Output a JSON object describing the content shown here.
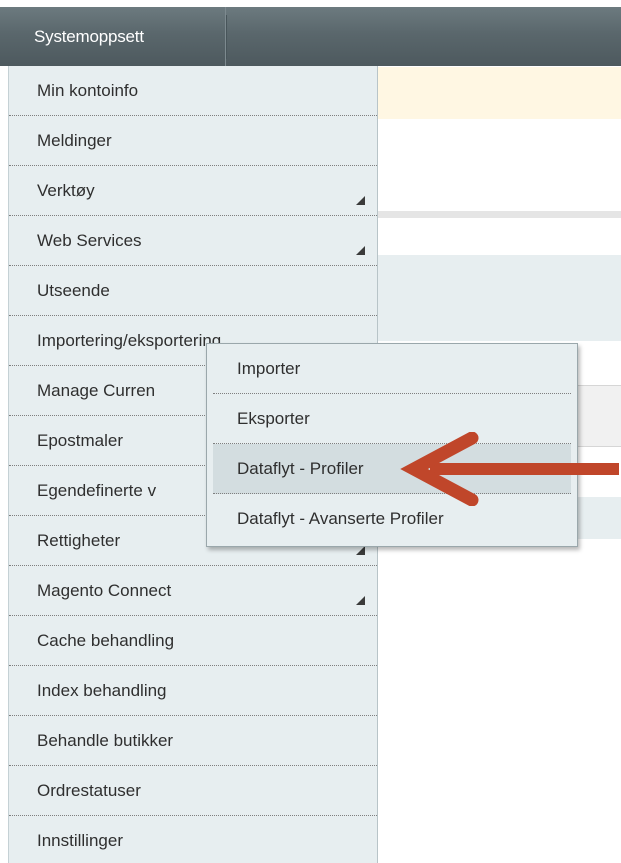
{
  "topbar": {
    "tab_label": "Systemoppsett"
  },
  "menu": {
    "items": [
      {
        "label": "Min kontoinfo",
        "has_submenu": false
      },
      {
        "label": "Meldinger",
        "has_submenu": false
      },
      {
        "label": "Verktøy",
        "has_submenu": true
      },
      {
        "label": "Web Services",
        "has_submenu": true
      },
      {
        "label": "Utseende",
        "has_submenu": false
      },
      {
        "label": "Importering/eksportering",
        "has_submenu": true
      },
      {
        "label": "Manage Curren",
        "has_submenu": false
      },
      {
        "label": "Epostmaler",
        "has_submenu": false
      },
      {
        "label": "Egendefinerte v",
        "has_submenu": false
      },
      {
        "label": "Rettigheter",
        "has_submenu": true
      },
      {
        "label": "Magento Connect",
        "has_submenu": true
      },
      {
        "label": "Cache behandling",
        "has_submenu": false
      },
      {
        "label": "Index behandling",
        "has_submenu": false
      },
      {
        "label": "Behandle butikker",
        "has_submenu": false
      },
      {
        "label": "Ordrestatuser",
        "has_submenu": false
      },
      {
        "label": "Innstillinger",
        "has_submenu": false
      }
    ]
  },
  "submenu": {
    "items": [
      {
        "label": "Importer"
      },
      {
        "label": "Eksporter"
      },
      {
        "label": "Dataflyt - Profiler",
        "active": true
      },
      {
        "label": "Dataflyt - Avanserte Profiler"
      }
    ]
  },
  "annotation": {
    "icon": "arrow-left-icon",
    "color": "#c0462a"
  },
  "colors": {
    "topbar": "#5a676c",
    "menu_bg": "#e7eef0",
    "notice_bg": "#fff7e3"
  }
}
